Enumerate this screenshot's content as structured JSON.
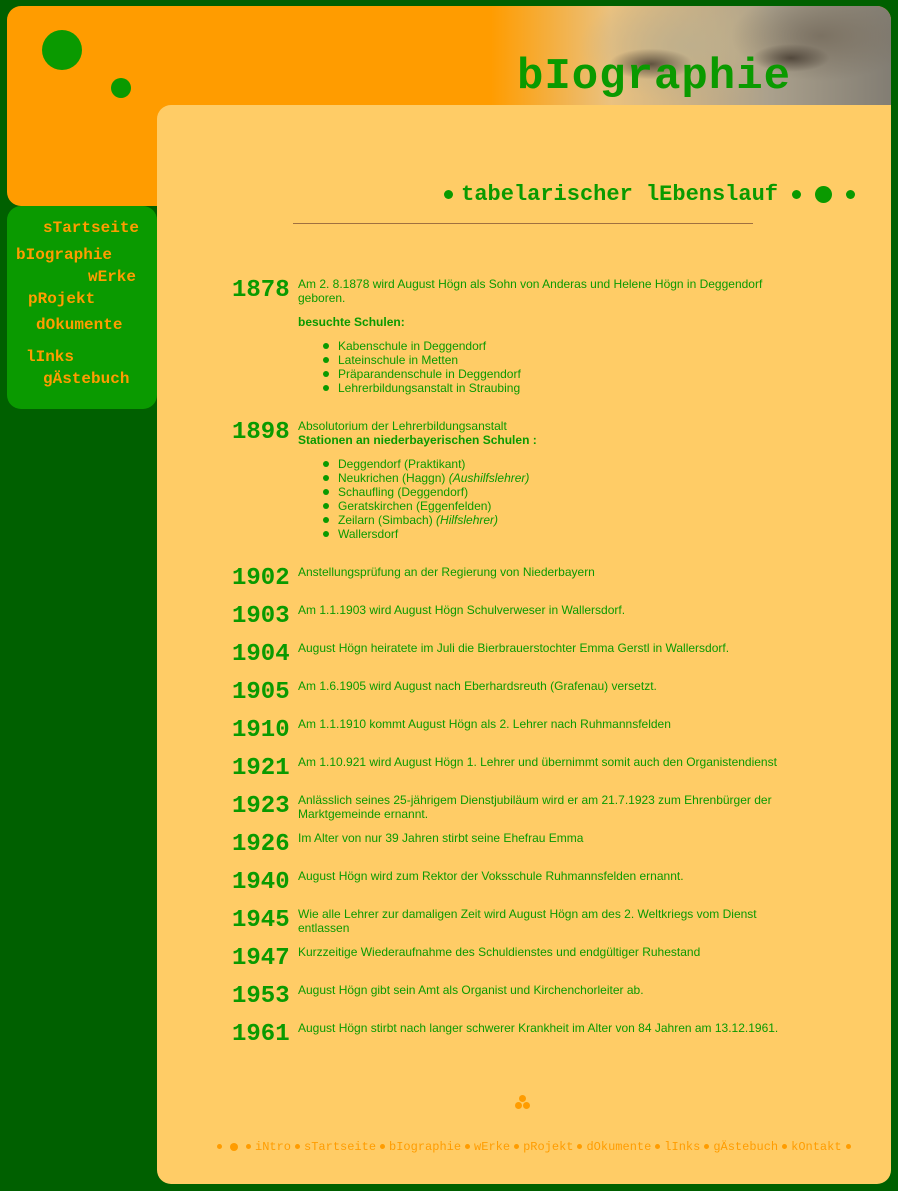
{
  "header": {
    "title": "bIographie"
  },
  "nav": {
    "startseite": "sTartseite",
    "biographie": "bIographie",
    "werke": "wErke",
    "projekt": "pRojekt",
    "dokumente": "dOkumente",
    "links": "lInks",
    "gaestebuch": "gÄstebuch"
  },
  "section": {
    "title": "tabelarischer lEbenslauf"
  },
  "entries": {
    "e1878": {
      "year": "1878",
      "text": "Am 2. 8.1878 wird August Högn als Sohn von Anderas und Helene Högn in Deggendorf geboren.",
      "sub": "besuchte Schulen:",
      "items": [
        "Kabenschule in Deggendorf",
        "Lateinschule in Metten",
        "Präparandenschule in Deggendorf",
        "Lehrerbildungsanstalt in Straubing"
      ]
    },
    "e1898": {
      "year": "1898",
      "text": "Absolutorium der Lehrerbildungsanstalt",
      "sub": "Stationen an niederbayerischen Schulen :",
      "items": [
        "Deggendorf (Praktikant)",
        "Neukrichen (Haggn)",
        "Schaufling (Deggendorf)",
        "Geratskirchen (Eggenfelden)",
        "Zeilarn (Simbach)",
        "Wallersdorf"
      ],
      "items_note_1": "(Aushilfslehrer)",
      "items_note_4": "(Hilfslehrer)"
    },
    "e1902": {
      "year": "1902",
      "text": "Anstellungsprüfung an der Regierung von Niederbayern"
    },
    "e1903": {
      "year": "1903",
      "text": "Am 1.1.1903 wird August Högn Schulverweser in Wallersdorf."
    },
    "e1904": {
      "year": "1904",
      "text": "August Högn heiratete im Juli die Bierbrauerstochter Emma Gerstl in Wallersdorf."
    },
    "e1905": {
      "year": "1905",
      "text": "Am 1.6.1905 wird August nach Eberhardsreuth (Grafenau) versetzt."
    },
    "e1910": {
      "year": "1910",
      "text": "Am 1.1.1910 kommt August Högn als 2. Lehrer nach Ruhmannsfelden"
    },
    "e1921": {
      "year": "1921",
      "text": "Am 1.10.921 wird August Högn 1. Lehrer und übernimmt somit auch den Organistendienst"
    },
    "e1923": {
      "year": "1923",
      "text": "Anlässlich seines 25-jährigem Dienstjubiläum wird er am 21.7.1923 zum Ehrenbürger der Marktgemeinde ernannt."
    },
    "e1926": {
      "year": "1926",
      "text": "Im Alter von nur 39 Jahren stirbt seine Ehefrau Emma"
    },
    "e1940": {
      "year": "1940",
      "text": "August Högn wird zum Rektor der Voksschule Ruhmannsfelden ernannt."
    },
    "e1945": {
      "year": "1945",
      "text": "Wie alle Lehrer zur damaligen Zeit wird August Högn am des 2. Weltkriegs vom Dienst entlassen"
    },
    "e1947": {
      "year": "1947",
      "text": "Kurzzeitige Wiederaufnahme des Schuldienstes und endgültiger Ruhestand"
    },
    "e1953": {
      "year": "1953",
      "text": "August Högn gibt sein Amt als Organist und Kirchenchorleiter ab."
    },
    "e1961": {
      "year": "1961",
      "text": "August Högn stirbt nach langer schwerer Krankheit im Alter von 84 Jahren am 13.12.1961."
    }
  },
  "footer": {
    "intro": "iNtro",
    "startseite": "sTartseite",
    "biographie": "bIographie",
    "werke": "wErke",
    "projekt": "pRojekt",
    "dokumente": "dOkumente",
    "links": "lInks",
    "gaestebuch": "gÄstebuch",
    "kontakt": "kOntakt"
  },
  "colors": {
    "background": "#006000",
    "green": "#0a9a00",
    "orange": "#ff9c00",
    "content": "#ffcc66"
  }
}
